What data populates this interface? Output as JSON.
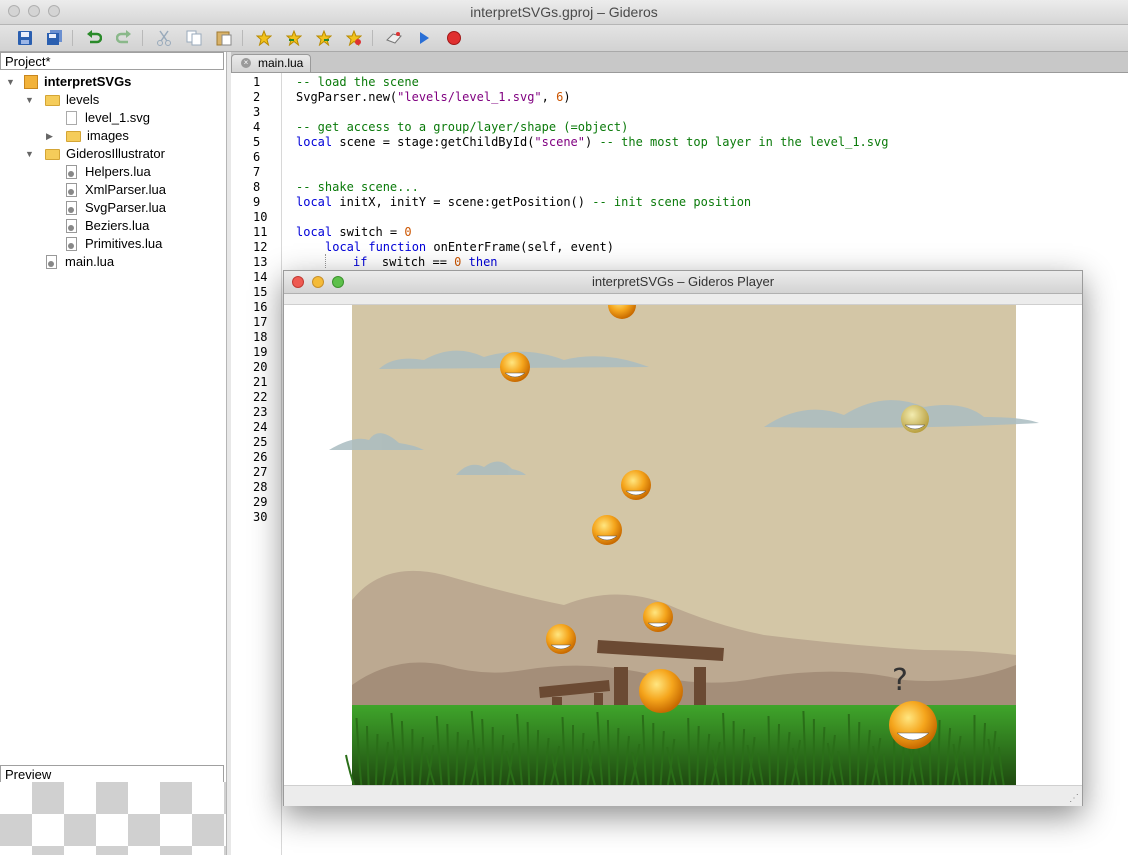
{
  "window": {
    "title": "interpretSVGs.gproj – Gideros"
  },
  "toolbar": {
    "icons": [
      "save-icon",
      "save-all-icon",
      "undo-icon",
      "redo-icon",
      "cut-icon",
      "copy-icon",
      "paste-icon",
      "star-icon",
      "star-forward-icon",
      "star-back-icon",
      "star-clear-icon",
      "start-player-icon",
      "play-icon",
      "stop-icon"
    ]
  },
  "project": {
    "header": "Project*",
    "root": "interpretSVGs",
    "items": [
      {
        "label": "levels"
      },
      {
        "label": "level_1.svg"
      },
      {
        "label": "images"
      },
      {
        "label": "GiderosIllustrator"
      },
      {
        "label": "Helpers.lua"
      },
      {
        "label": "XmlParser.lua"
      },
      {
        "label": "SvgParser.lua"
      },
      {
        "label": "Beziers.lua"
      },
      {
        "label": "Primitives.lua"
      },
      {
        "label": "main.lua"
      }
    ]
  },
  "preview": {
    "header": "Preview"
  },
  "editor": {
    "tab": "main.lua",
    "line_numbers": [
      "1",
      "2",
      "3",
      "4",
      "5",
      "6",
      "7",
      "8",
      "9",
      "10",
      "11",
      "12",
      "13",
      "14",
      "15",
      "16",
      "17",
      "18",
      "19",
      "20",
      "21",
      "22",
      "23",
      "24",
      "25",
      "26",
      "27",
      "28",
      "29",
      "30"
    ]
  },
  "code": {
    "l1": "-- load the scene",
    "l2a": "SvgParser.new(",
    "l2b": "\"levels/level_1.svg\"",
    "l2c": ", ",
    "l2d": "6",
    "l2e": ")",
    "l4": "-- get access to a group/layer/shape (=object)",
    "l5a": "local",
    "l5b": " scene = stage:getChildById(",
    "l5c": "\"scene\"",
    "l5d": ") ",
    "l5e": "-- the most top layer in the level_1.svg",
    "l8": "-- shake scene...",
    "l9a": "local",
    "l9b": " initX, initY = scene:getPosition() ",
    "l9c": "-- init scene position",
    "l11a": "local",
    "l11b": " switch = ",
    "l11c": "0",
    "l12a": "local",
    "l12b": " ",
    "l12c": "function",
    "l12d": " onEnterFrame(self, event)",
    "l13a": "if",
    "l13b": "  switch == ",
    "l13c": "0",
    "l13d": " ",
    "l13e": "then"
  },
  "player": {
    "title": "interpretSVGs – Gideros Player"
  },
  "game": {
    "question_mark": "?"
  }
}
